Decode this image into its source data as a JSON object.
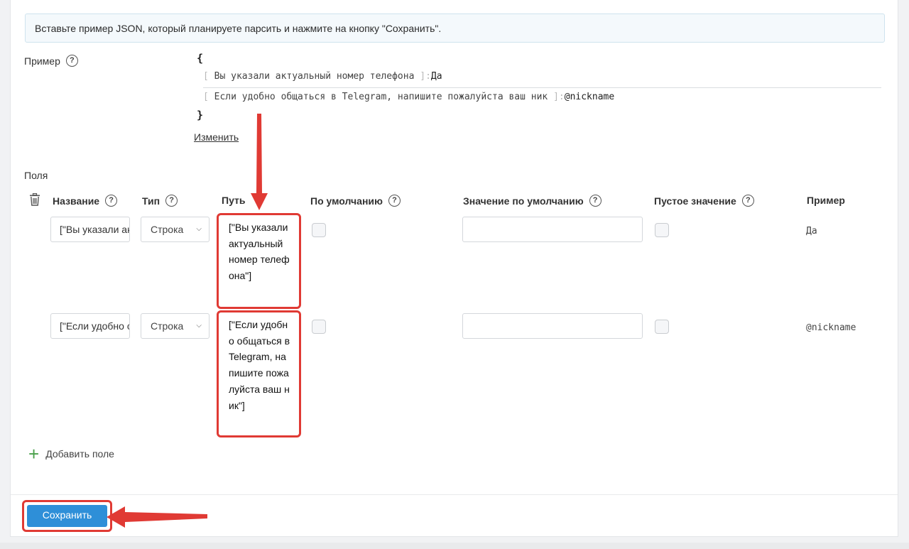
{
  "info_text": "Вставьте пример JSON, который планируете парсить и нажмите на кнопку \"Сохранить\".",
  "example": {
    "label": "Пример",
    "open_brace": "{",
    "close_brace": "}",
    "lines": [
      {
        "bracket_open": "[",
        "key": "Вы указали актуальный номер телефона",
        "bracket_close": "]",
        "colon": ":",
        "value": "Да"
      },
      {
        "bracket_open": "[",
        "key": "Если удобно общаться в Telegram, напишите пожалуйста ваш ник",
        "bracket_close": "]",
        "colon": ":",
        "value": "@nickname"
      }
    ],
    "edit_link": "Изменить"
  },
  "fields": {
    "title": "Поля",
    "headers": {
      "name": "Название",
      "type": "Тип",
      "path": "Путь",
      "default": "По умолчанию",
      "default_value": "Значение по умолчанию",
      "empty_value": "Пустое значение",
      "example": "Пример"
    },
    "help_icon_glyph": "?",
    "rows": [
      {
        "name": "[\"Вы указали актуальный номер телефона\"]",
        "type": "Строка",
        "path": "[\"Вы указали актуальный номер телефона\"]",
        "default_value": "",
        "example": "Да"
      },
      {
        "name": "[\"Если удобно общаться в Telegram, напишите пожалуйста ваш ник\"]",
        "type": "Строка",
        "path": "[\"Если удобно общаться в Telegram, напишите пожалуйста ваш ник\"]",
        "default_value": "",
        "example": "@nickname"
      }
    ],
    "add_field": "Добавить поле"
  },
  "save_button": "Сохранить",
  "colors": {
    "accent_blue": "#2e8fd8",
    "annotation_red": "#e03a34",
    "add_green": "#49a04a"
  },
  "icons": [
    "help-icon",
    "trash-icon",
    "chevron-down-icon",
    "plus-icon"
  ]
}
